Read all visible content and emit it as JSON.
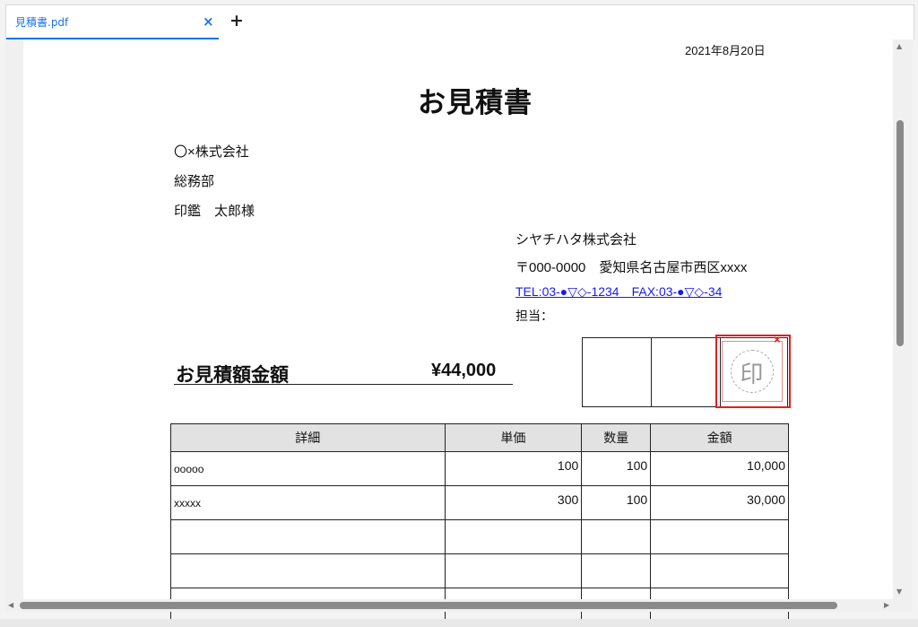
{
  "tab": {
    "title": "見積書.pdf",
    "close_glyph": "×",
    "add_glyph": "+"
  },
  "document": {
    "date": "2021年8月20日",
    "title": "お見積書",
    "recipient": {
      "company": "〇×株式会社",
      "department": "総務部",
      "person": "印鑑　太郎様"
    },
    "sender": {
      "company": "シヤチハタ株式会社",
      "address": "〒000-0000　愛知県名古屋市西区xxxx",
      "contact": "TEL:03-●▽◇-1234　FAX:03-●▽◇-34",
      "person_label": "担当："
    },
    "amount_label": "お見積額金額",
    "amount_value": "¥44,000",
    "stamp": {
      "char": "印",
      "delete_glyph": "×",
      "selection_color": "#e02020"
    },
    "table": {
      "headers": [
        "詳細",
        "単価",
        "数量",
        "金額"
      ],
      "rows": [
        [
          "ooooo",
          "100",
          "100",
          "10,000"
        ],
        [
          "xxxxx",
          "300",
          "100",
          "30,000"
        ],
        [
          "",
          "",
          "",
          ""
        ],
        [
          "",
          "",
          "",
          ""
        ],
        [
          "",
          "",
          "",
          ""
        ]
      ]
    }
  },
  "scrollbars": {
    "up_arrow": "▲",
    "down_arrow": "▼",
    "left_arrow": "◀",
    "right_arrow": "▶"
  },
  "colors": {
    "accent": "#1a73e8",
    "link": "#1a1aee",
    "header_fill": "#e2e2e2"
  }
}
